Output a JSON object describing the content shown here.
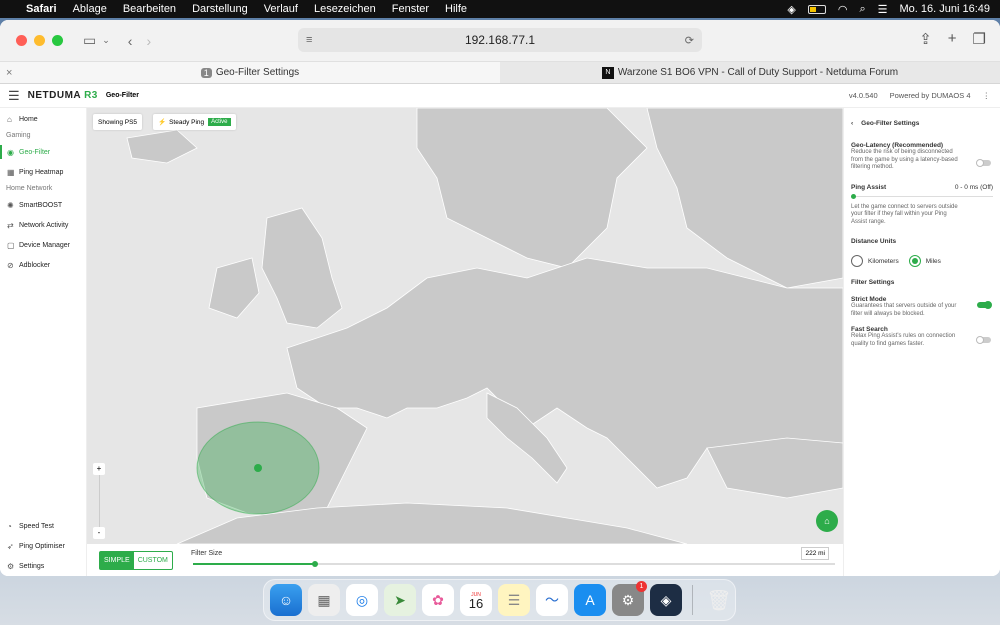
{
  "menubar": {
    "items": [
      "Safari",
      "Ablage",
      "Bearbeiten",
      "Darstellung",
      "Verlauf",
      "Lesezeichen",
      "Fenster",
      "Hilfe"
    ],
    "datetime": "Mo. 16. Juni  16:49"
  },
  "browser": {
    "address": "192.168.77.1",
    "tabs": [
      {
        "num": "1",
        "title": "Geo-Filter Settings"
      },
      {
        "fav": "N",
        "title": "Warzone S1 BO6 VPN - Call of Duty Support - Netduma Forum"
      }
    ]
  },
  "app": {
    "logo": "NETDUMA",
    "logo_suffix": "R3",
    "page_name": "Geo-Filter",
    "version": "v4.0.540",
    "powered": "Powered by DUMAOS 4"
  },
  "sidebar": {
    "items_top": [
      {
        "label": "Home",
        "icon": "home-icon"
      }
    ],
    "section_gaming": "Gaming",
    "gaming_items": [
      {
        "label": "Geo-Filter",
        "icon": "geo-filter-icon"
      },
      {
        "label": "Ping Heatmap",
        "icon": "heatmap-icon"
      }
    ],
    "section_home": "Home Network",
    "home_items": [
      {
        "label": "SmartBOOST"
      },
      {
        "label": "Network Activity"
      },
      {
        "label": "Device Manager"
      },
      {
        "label": "Adblocker"
      }
    ],
    "bottom_items": [
      {
        "label": "Speed Test"
      },
      {
        "label": "Ping Optimiser"
      },
      {
        "label": "Settings"
      }
    ]
  },
  "map": {
    "showing": "Showing PS5",
    "steady_ping": "Steady Ping",
    "steady_status": "Active"
  },
  "footer": {
    "simple": "SIMPLE",
    "custom": "CUSTOM",
    "filter_size_label": "Filter Size",
    "filter_size_value": "222 mi",
    "filter_size_fraction": 0.19
  },
  "panel": {
    "title": "Geo-Filter Settings",
    "geo_latency_title": "Geo-Latency (Recommended)",
    "geo_latency_desc": "Reduce the risk of being disconnected from the game by using a latency-based filtering method.",
    "ping_assist_title": "Ping Assist",
    "ping_assist_value": "0 - 0 ms  (Off)",
    "ping_assist_desc": "Let the game connect to servers outside your filter if they fall within your Ping Assist range.",
    "distance_units": "Distance Units",
    "kilometers": "Kilometers",
    "miles": "Miles",
    "filter_settings": "Filter Settings",
    "strict_title": "Strict Mode",
    "strict_desc": "Guarantees that servers outside of your filter will always be blocked.",
    "fast_title": "Fast Search",
    "fast_desc": "Relax Ping Assist's rules on connection quality to find games faster."
  },
  "dock": {
    "calendar_month": "JUN",
    "calendar_day": "16",
    "settings_badge": "1"
  },
  "colors": {
    "accent": "#2dac4a"
  }
}
